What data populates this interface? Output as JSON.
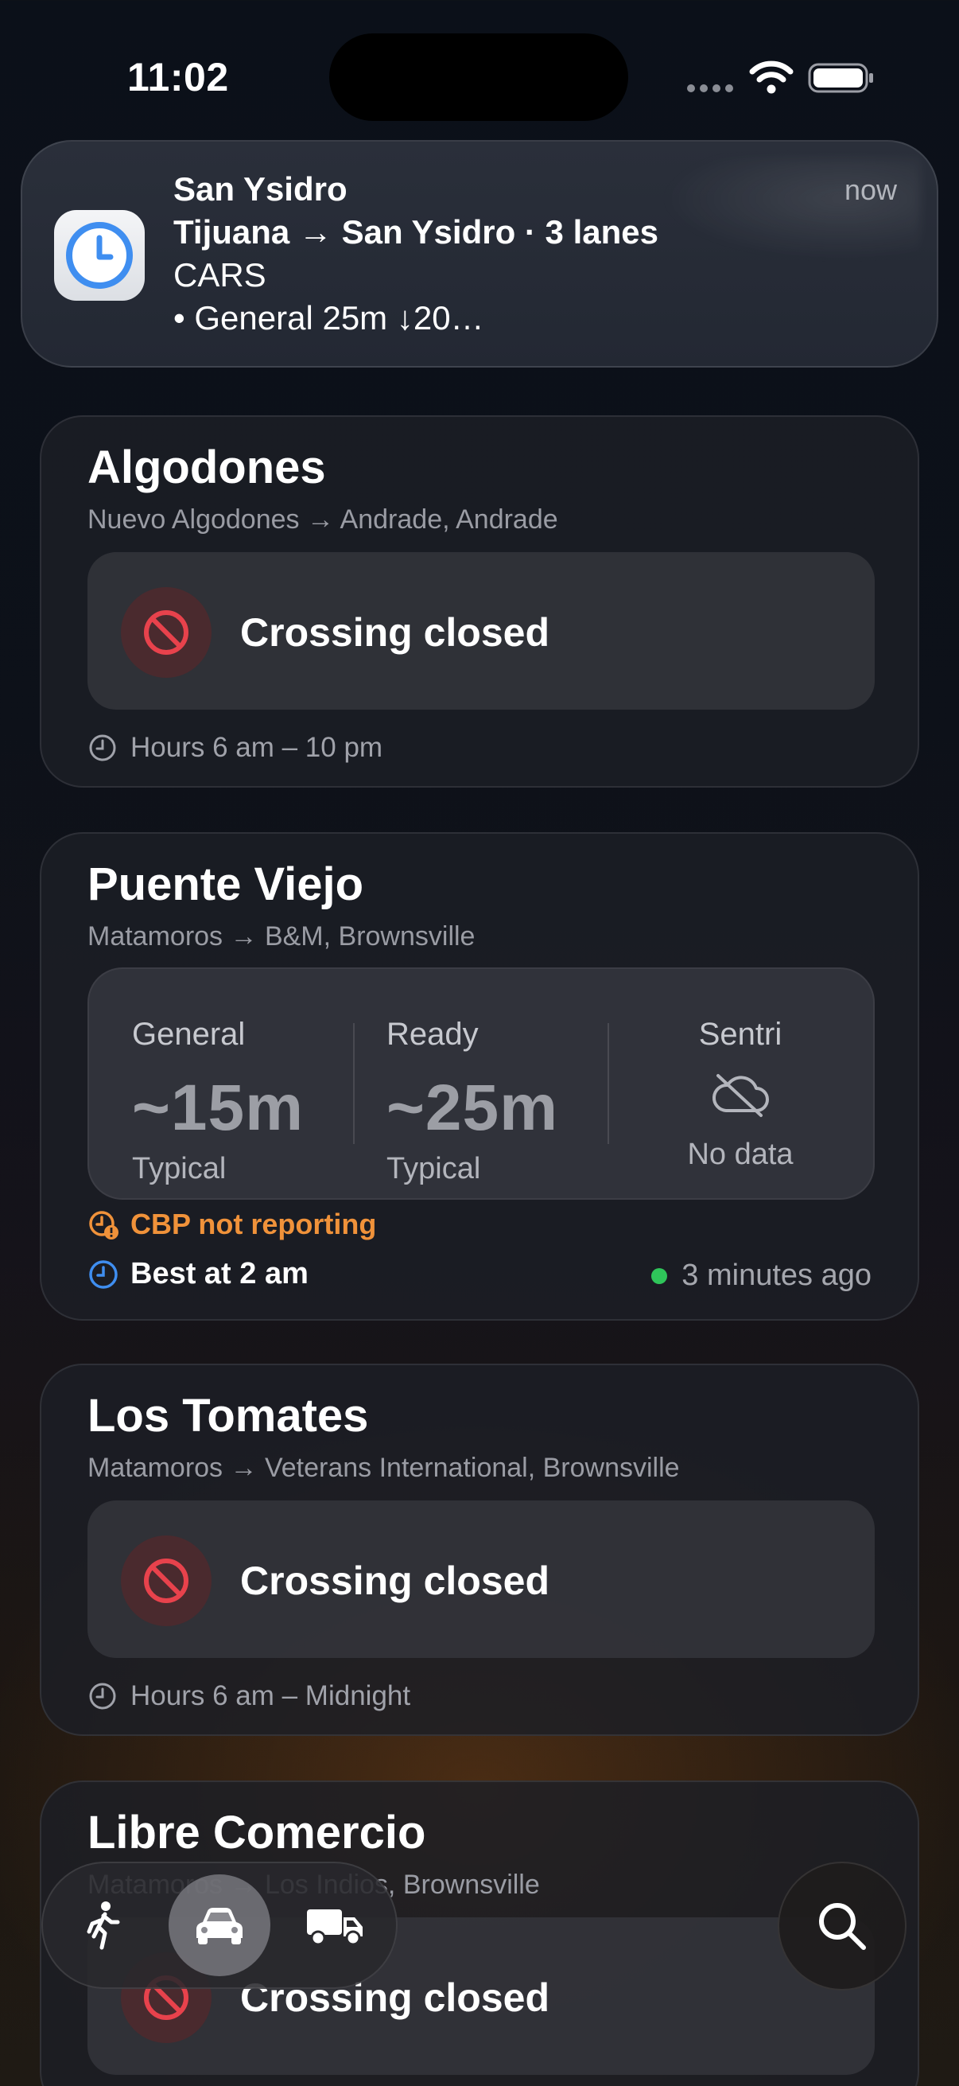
{
  "status_bar": {
    "time": "11:02"
  },
  "notification": {
    "title": "San Ysidro",
    "line1": "Tijuana → San Ysidro · 3 lanes",
    "line2": "CARS",
    "line3": "• General 25m ↓20…",
    "time": "now",
    "app_icon": "clock-icon"
  },
  "cards": [
    {
      "title": "Algodones",
      "subtitle": "Nuevo Algodones → Andrade, Andrade",
      "status": "Crossing closed",
      "hours": "Hours 6 am – 10 pm"
    },
    {
      "title": "Puente Viejo",
      "subtitle": "Matamoros → B&M, Brownsville",
      "general": {
        "label": "General",
        "value": "~15m",
        "caption": "Typical"
      },
      "ready": {
        "label": "Ready",
        "value": "~25m",
        "caption": "Typical"
      },
      "sentri": {
        "label": "Sentri",
        "caption": "No data"
      },
      "warning": "CBP not reporting",
      "best": "Best at 2 am",
      "updated": "3 minutes ago"
    },
    {
      "title": "Los Tomates",
      "subtitle": "Matamoros → Veterans International, Brownsville",
      "status": "Crossing closed",
      "hours": "Hours 6 am – Midnight"
    },
    {
      "title": "Libre Comercio",
      "subtitle": "Matamoros → Los Indios, Brownsville",
      "status": "Crossing closed"
    }
  ],
  "tab_bar": {
    "modes": [
      "pedestrian-icon",
      "car-icon",
      "truck-icon"
    ],
    "active": "car-icon"
  },
  "colors": {
    "closed_red": "#e8424c",
    "warning_orange": "#f0923a",
    "clock_blue": "#3f8ef0",
    "live_green": "#2fc55a"
  }
}
